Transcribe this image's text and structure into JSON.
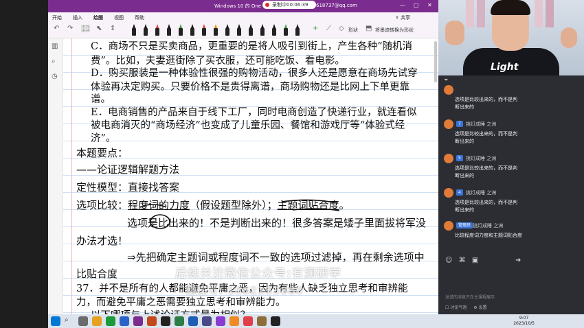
{
  "window": {
    "title": "Windows 10 的 One",
    "recording": "录制中00:06:39",
    "account": "618737@qq.com",
    "minimize": "—",
    "maximize": "▢",
    "close": "✕"
  },
  "ribbon": {
    "tabs": [
      "开始",
      "插入",
      "绘图",
      "视图",
      "帮助"
    ],
    "active_tab": "绘图",
    "share": "共享"
  },
  "toolbar": {
    "undo": "↶",
    "redo": "↷",
    "shape_label": "形状",
    "ink_to_shape_label": "将墨迹转换为形状",
    "pen_colors": [
      "#111111",
      "#111111",
      "#e53935",
      "#111111",
      "#43a047",
      "#111111",
      "#e53935",
      "#fb8c00",
      "#111111",
      "#111111",
      "#111111",
      "#111111",
      "#111111",
      "#43a047",
      "#111111"
    ]
  },
  "document": {
    "option_c_1": "C．商场不只是买卖商品，更重要的是将人吸引到街上，产生各种“随机消",
    "option_c_2": "费”。比如，夫妻逛街除了买衣服，还可能吃饭、看电影。",
    "option_d_1": "D．购买服装是一种体验性很强的购物活动，很多人还是愿意在商场先试穿",
    "option_d_2": "体验再决定购买。只要价格不是贵得离谱，商场购物还是比网上下单更靠",
    "option_d_3": "谱。",
    "option_e_1": "E．电商销售的产品来自于线下工厂，同时电商创造了快递行业，就连看似",
    "option_e_2": "被电商消灭的“商场经济”也变成了儿童乐园、餐馆和游戏厅等“体验式经",
    "option_e_3": "济”。",
    "key_points": "本题要点：",
    "method": "——论证逻辑解题方法",
    "model": "定性模型：直接找答案",
    "compare_prefix": "选项比较：",
    "compare_degree": "程度词的力度",
    "compare_mid": "（假设题型除外）；",
    "compare_topic": "主题词贴合度",
    "compare_end": "。",
    "note_1": "选项是比出来的！不是判断出来的！很多答案是矮子里面拔将军没",
    "note_2": "办法才选！",
    "filter_1": "⇒先把确定主题词或程度词不一致的选项过滤掉，再在剩余选项中",
    "filter_2": "比贴合度",
    "q37_1": "37．并不是所有的人都能避免平庸之恶，因为有些人缺乏独立思考和审辨能",
    "q37_2": "力，而避免平庸之恶需要独立思考和审辨能力。",
    "q37_3": "以下哪项与上述论证方式最为相似？"
  },
  "watermark": {
    "line1": "后续关注微信公众号:有润研学",
    "line2": "微信号: 1662233888"
  },
  "video": {
    "shirt_logo": "Light"
  },
  "chat": {
    "messages": [
      {
        "badge": "",
        "user": "",
        "lines": [
          "选项是比较出来的，而不是判",
          "断出来的"
        ]
      },
      {
        "badge": "7",
        "user": "挑灯成睡 之洲",
        "lines": [
          "选项是比较出来的，而不是判",
          "断出来的"
        ]
      },
      {
        "badge": "5",
        "user": "挑灯成睡 之洲",
        "lines": [
          "选项是比较出来的，而不是判",
          "断出来的"
        ]
      },
      {
        "badge": "4",
        "user": "挑灯成睡 之洲",
        "lines": [
          "选项是比较出来的，而不是判",
          "断出来的"
        ]
      },
      {
        "badge": "管理员",
        "user": "挑灯成睡 之洲",
        "lines": [
          "比较程度词力度和主题词贴合度"
        ]
      }
    ],
    "hint": "发送的消息只在主课程展示",
    "bottom_left": "讨论气泡",
    "bottom_right": "设置"
  },
  "taskbar": {
    "time": "9:07",
    "date": "2023/10/5"
  }
}
